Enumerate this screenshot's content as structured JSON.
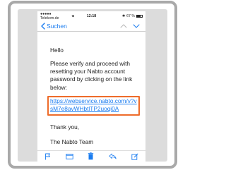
{
  "statusbar": {
    "carrier": "●●●●● Telekom.de",
    "time": "12:18",
    "battery_text": "67 %",
    "battery_level": 0.67
  },
  "nav": {
    "back_label": "Suchen"
  },
  "email": {
    "greeting": "Hello",
    "body": "Please verify and proceed with resetting your Nabto account password by clicking on the link below:",
    "link": "https://webservice.nabto.com/v?vsM7e8avWHbtlTP2uoqi0A",
    "thanks": "Thank you,",
    "signoff": "The Nabto Team"
  },
  "icons": {
    "flag": "flag-icon",
    "folder": "folder-icon",
    "trash": "trash-icon",
    "reply": "reply-icon",
    "compose": "compose-icon"
  },
  "colors": {
    "accent": "#1a7cf0",
    "highlight": "#ee6c2a"
  }
}
